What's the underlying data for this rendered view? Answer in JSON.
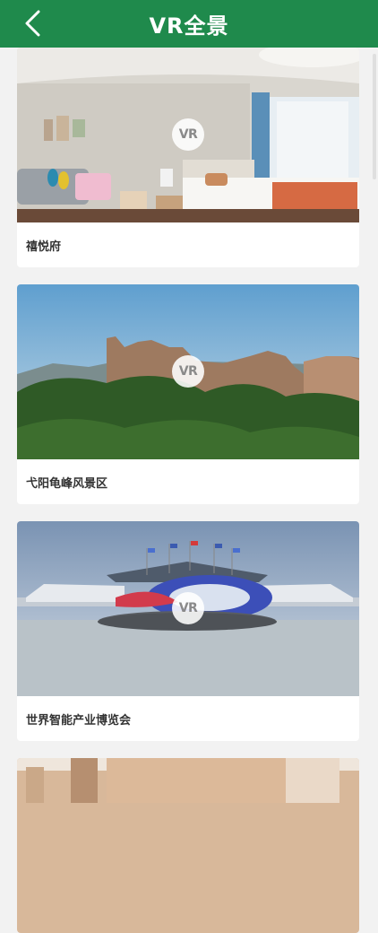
{
  "header": {
    "title": "VR全景",
    "back_icon": "chevron-left-icon"
  },
  "colors": {
    "header_bg": "#1f8a4c",
    "background": "#f2f2f2",
    "card_bg": "#ffffff"
  },
  "items": [
    {
      "label": "禧悦府",
      "badge": "VR"
    },
    {
      "label": "弋阳龟峰风景区",
      "badge": "VR"
    },
    {
      "label": "世界智能产业博览会",
      "badge": "VR"
    },
    {
      "label": "",
      "badge": ""
    }
  ]
}
